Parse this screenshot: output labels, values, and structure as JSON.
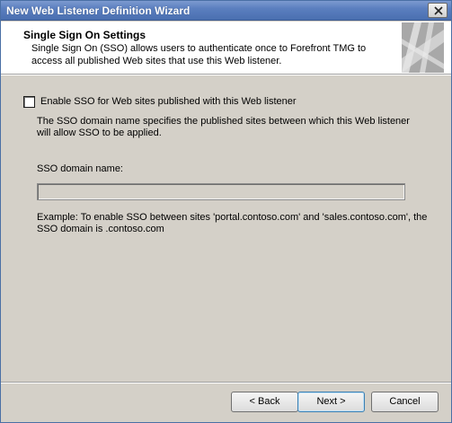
{
  "window": {
    "title": "New Web Listener Definition Wizard",
    "accent_color": "#5b7fbf"
  },
  "header": {
    "title": "Single Sign On Settings",
    "description": "Single Sign On (SSO) allows users to authenticate once to Forefront TMG to access all published Web sites that use this Web listener."
  },
  "content": {
    "enable_sso": {
      "label": "Enable SSO for Web sites published with this Web listener",
      "checked": false
    },
    "explanation": "The SSO domain name specifies the published sites between which this Web listener will allow SSO to be applied.",
    "sso_domain": {
      "label": "SSO domain name:",
      "value": "",
      "enabled": false
    },
    "example": "Example: To enable SSO between sites 'portal.contoso.com' and 'sales.contoso.com', the SSO domain is .contoso.com"
  },
  "buttons": {
    "back": "< Back",
    "next": "Next >",
    "cancel": "Cancel"
  },
  "icons": {
    "close": "close-icon",
    "header_graphic": "wizard-graphic-icon"
  }
}
